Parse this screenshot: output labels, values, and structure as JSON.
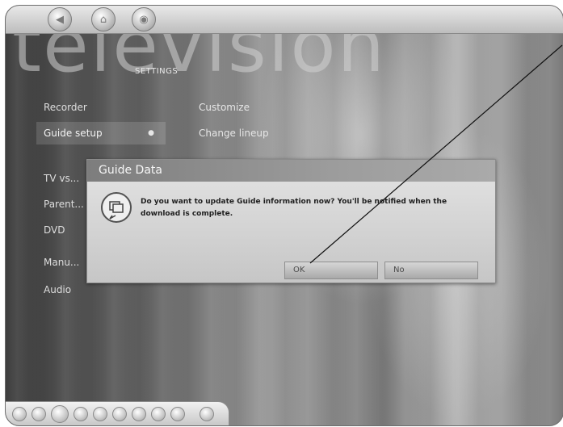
{
  "header": {
    "nav_icons": [
      "back-icon",
      "home-icon",
      "media-center-logo-icon"
    ]
  },
  "watermark": {
    "text": "television"
  },
  "page": {
    "section_title": "SETTINGS"
  },
  "left_menu": {
    "items": [
      {
        "label": "Recorder"
      },
      {
        "label": "Guide setup",
        "selected": true
      },
      {
        "label": "TV vs..."
      },
      {
        "label": "Parent..."
      },
      {
        "label": "DVD"
      },
      {
        "label": "Manu..."
      },
      {
        "label": "Audio"
      }
    ]
  },
  "options": {
    "items": [
      {
        "label": "Customize"
      },
      {
        "label": "Change lineup"
      }
    ]
  },
  "dialog": {
    "title": "Guide Data",
    "message": "Do you want to update Guide information now? You'll be notified when the download is complete.",
    "buttons": [
      {
        "label": "OK"
      },
      {
        "label": "No"
      }
    ]
  },
  "transport": {
    "controls": [
      "shuffle-icon",
      "repeat-icon",
      "play-icon",
      "stop-icon",
      "pause-icon",
      "skip-back-icon",
      "skip-forward-icon",
      "rewind-icon",
      "fast-forward-icon",
      "mute-icon"
    ]
  },
  "colors": {
    "background_dark": "#3d3d3d",
    "background_light": "#b3b3b3",
    "dialog_bg": "#d8d8d8",
    "dialog_title": "#8d8d8d",
    "text_light": "#e6e6e6",
    "text_dark": "#1f1f1f",
    "frame_border": "#6e6e6e"
  }
}
